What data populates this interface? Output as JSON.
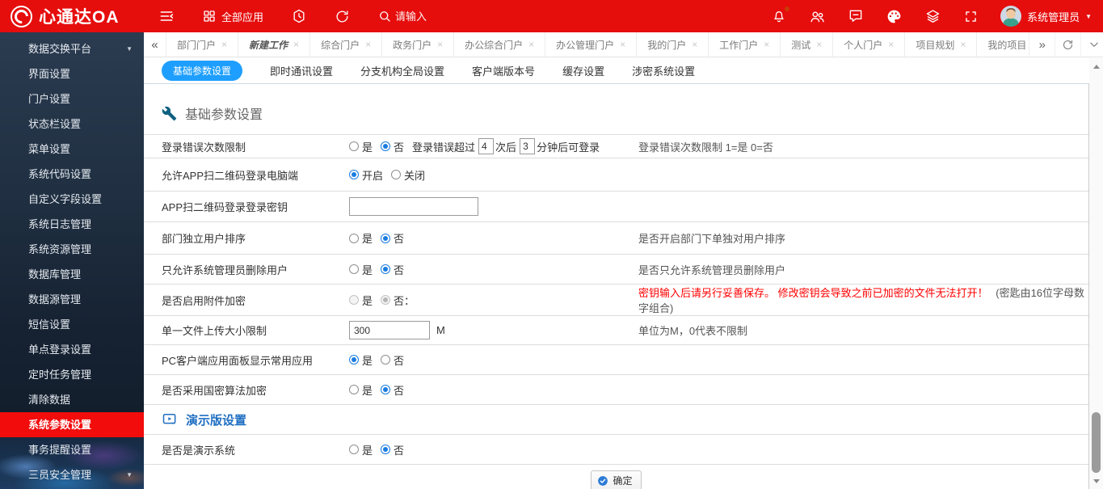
{
  "topbar": {
    "logo": "心通达OA",
    "all_apps": "全部应用",
    "search_placeholder": "请输入",
    "username": "系统管理员"
  },
  "sidebar": {
    "items": [
      {
        "label": "数据交换平台"
      },
      {
        "label": "界面设置"
      },
      {
        "label": "门户设置"
      },
      {
        "label": "状态栏设置"
      },
      {
        "label": "菜单设置"
      },
      {
        "label": "系统代码设置"
      },
      {
        "label": "自定义字段设置"
      },
      {
        "label": "系统日志管理"
      },
      {
        "label": "系统资源管理"
      },
      {
        "label": "数据库管理"
      },
      {
        "label": "数据源管理"
      },
      {
        "label": "短信设置"
      },
      {
        "label": "单点登录设置"
      },
      {
        "label": "定时任务管理"
      },
      {
        "label": "清除数据"
      },
      {
        "label": "系统参数设置"
      },
      {
        "label": "事务提醒设置"
      },
      {
        "label": "三员安全管理"
      }
    ]
  },
  "tabs": {
    "items": [
      "部门门户",
      "新建工作",
      "综合门户",
      "政务门户",
      "办公综合门户",
      "办公管理门户",
      "我的门户",
      "工作门户",
      "测试",
      "个人门户",
      "项目规划",
      "我的项目"
    ]
  },
  "subtabs": {
    "items": [
      "基础参数设置",
      "即时通讯设置",
      "分支机构全局设置",
      "客户端版本号",
      "缓存设置",
      "涉密系统设置"
    ]
  },
  "form": {
    "section1_title": "基础参数设置",
    "section2_title": "演示版设置",
    "yes": "是",
    "no": "否",
    "rows": {
      "login_limit": {
        "label": "登录错误次数限制",
        "text1": "登录错误超过",
        "attempts": "4",
        "text2": "次后",
        "minutes": "3",
        "text3": "分钟后可登录",
        "hint": "登录错误次数限制 1=是   0=否"
      },
      "app_qr": {
        "label": "允许APP扫二维码登录电脑端",
        "on": "开启",
        "off": "关闭"
      },
      "app_qr_key": {
        "label": "APP扫二维码登录登录密钥",
        "value": ""
      },
      "dept_sort": {
        "label": "部门独立用户排序",
        "hint": "是否开启部门下单独对用户排序"
      },
      "admin_delete": {
        "label": "只允许系统管理员删除用户",
        "hint": "是否只允许系统管理员删除用户"
      },
      "attach_encrypt": {
        "label": "是否启用附件加密",
        "no": "否：",
        "hint_red": "密钥输入后请另行妥善保存。 修改密钥会导致之前已加密的文件无法打开！",
        "hint_gray": "(密匙由16位字母数字组合)"
      },
      "file_size": {
        "label": "单一文件上传大小限制",
        "value": "300",
        "unit": "M",
        "hint": "单位为M，0代表不限制"
      },
      "pc_panel": {
        "label": "PC客户端应用面板显示常用应用"
      },
      "gm_encrypt": {
        "label": "是否采用国密算法加密"
      },
      "demo_system": {
        "label": "是否是演示系统"
      }
    },
    "confirm_label": "确定"
  },
  "colors": {
    "topbar_red": "#e60d0d",
    "active_red": "#f20c0c",
    "accent_blue": "#1e9fff",
    "section_blue": "#1f6ec2",
    "warning_red": "#ff0000",
    "wrench_teal": "#0e6080"
  }
}
